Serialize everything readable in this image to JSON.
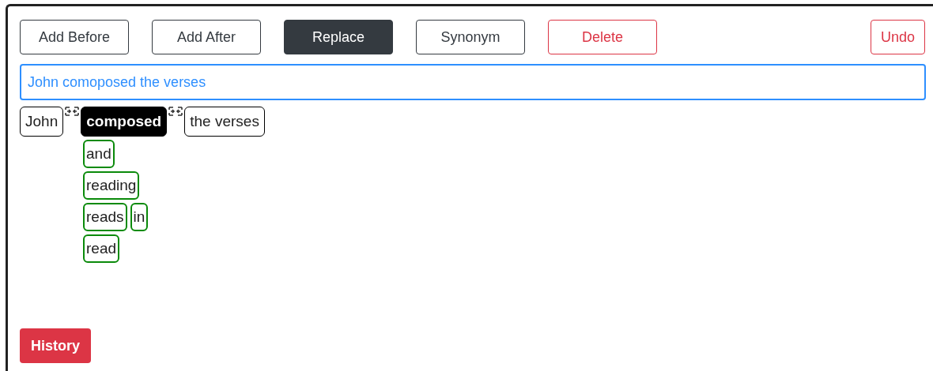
{
  "toolbar": [
    {
      "label": "Add Before",
      "kind": "outline"
    },
    {
      "label": "Add After",
      "kind": "outline"
    },
    {
      "label": "Replace",
      "kind": "solid"
    },
    {
      "label": "Synonym",
      "kind": "outline"
    },
    {
      "label": "Delete",
      "kind": "danger-outline"
    }
  ],
  "undo": {
    "label": "Undo",
    "kind": "danger-outline"
  },
  "sentence_field": {
    "value": "John comoposed the verses"
  },
  "tokens": [
    {
      "text": "John",
      "selected": false
    },
    {
      "text": "composed",
      "selected": true
    },
    {
      "text": "the verses",
      "selected": false
    }
  ],
  "suggestions": [
    [
      "and"
    ],
    [
      "reading"
    ],
    [
      "reads",
      "in"
    ],
    [
      "read"
    ]
  ],
  "history": {
    "label": "History",
    "kind": "danger"
  }
}
